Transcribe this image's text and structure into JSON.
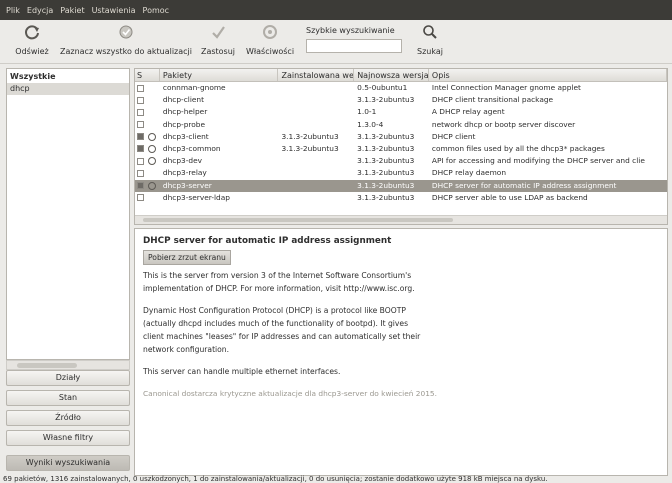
{
  "menu": [
    "Plik",
    "Edycja",
    "Pakiet",
    "Ustawienia",
    "Pomoc"
  ],
  "toolbar": {
    "refresh": "Odśwież",
    "select_updates": "Zaznacz wszystko do aktualizacji",
    "apply": "Zastosuj",
    "properties": "Właściwości",
    "search_label": "Szybkie wyszukiwanie",
    "search_value": "",
    "search_button": "Szukaj"
  },
  "filters": {
    "header": "Wszystkie",
    "items": [
      "dhcp"
    ]
  },
  "categories": [
    "Działy",
    "Stan",
    "Źródło",
    "Własne filtry",
    "Wyniki wyszukiwania"
  ],
  "table": {
    "headers": [
      "S",
      "Pakiety",
      "Zainstalowana we",
      "Najnowsza wersja",
      "Opis"
    ],
    "rows": [
      {
        "checked": false,
        "installed": false,
        "name": "connman-gnome",
        "inst": "",
        "latest": "0.5-0ubuntu1",
        "desc": "Intel Connection Manager gnome applet"
      },
      {
        "checked": false,
        "installed": false,
        "name": "dhcp-client",
        "inst": "",
        "latest": "3.1.3-2ubuntu3",
        "desc": "DHCP client transitional package"
      },
      {
        "checked": false,
        "installed": false,
        "name": "dhcp-helper",
        "inst": "",
        "latest": "1.0-1",
        "desc": "A DHCP relay agent"
      },
      {
        "checked": false,
        "installed": false,
        "name": "dhcp-probe",
        "inst": "",
        "latest": "1.3.0-4",
        "desc": "network dhcp or bootp server discover"
      },
      {
        "checked": true,
        "installed": true,
        "name": "dhcp3-client",
        "inst": "3.1.3-2ubuntu3",
        "latest": "3.1.3-2ubuntu3",
        "desc": "DHCP client"
      },
      {
        "checked": true,
        "installed": true,
        "name": "dhcp3-common",
        "inst": "3.1.3-2ubuntu3",
        "latest": "3.1.3-2ubuntu3",
        "desc": "common files used by all the dhcp3* packages"
      },
      {
        "checked": false,
        "installed": true,
        "name": "dhcp3-dev",
        "inst": "",
        "latest": "3.1.3-2ubuntu3",
        "desc": "API for accessing and modifying the DHCP server and clie"
      },
      {
        "checked": false,
        "installed": false,
        "name": "dhcp3-relay",
        "inst": "",
        "latest": "3.1.3-2ubuntu3",
        "desc": "DHCP relay daemon"
      },
      {
        "checked": true,
        "installed": true,
        "name": "dhcp3-server",
        "inst": "",
        "latest": "3.1.3-2ubuntu3",
        "desc": "DHCP server for automatic IP address assignment",
        "selected": true
      },
      {
        "checked": false,
        "installed": false,
        "name": "dhcp3-server-ldap",
        "inst": "",
        "latest": "3.1.3-2ubuntu3",
        "desc": "DHCP server able to use LDAP as backend"
      }
    ]
  },
  "details": {
    "title": "DHCP server for automatic IP address assignment",
    "screenshot_button": "Pobierz zrzut ekranu",
    "p1": "This is the server from version 3 of the Internet Software Consortium's implementation of DHCP. For more information, visit http://www.isc.org.",
    "p2": "Dynamic Host Configuration Protocol (DHCP) is a protocol like BOOTP (actually dhcpd includes much of the functionality of bootpd). It gives client machines \"leases\" for IP addresses and can automatically set their network configuration.",
    "p3": "This server can handle multiple ethernet interfaces.",
    "note": "Canonical dostarcza krytyczne aktualizacje dla dhcp3-server do kwiecień 2015."
  },
  "status": "69 pakietów, 1316 zainstalowanych, 0 uszkodzonych, 1 do zainstalowania/aktualizacji, 0 do usunięcia; zostanie dodatkowo użyte 918 kB miejsca na dysku."
}
